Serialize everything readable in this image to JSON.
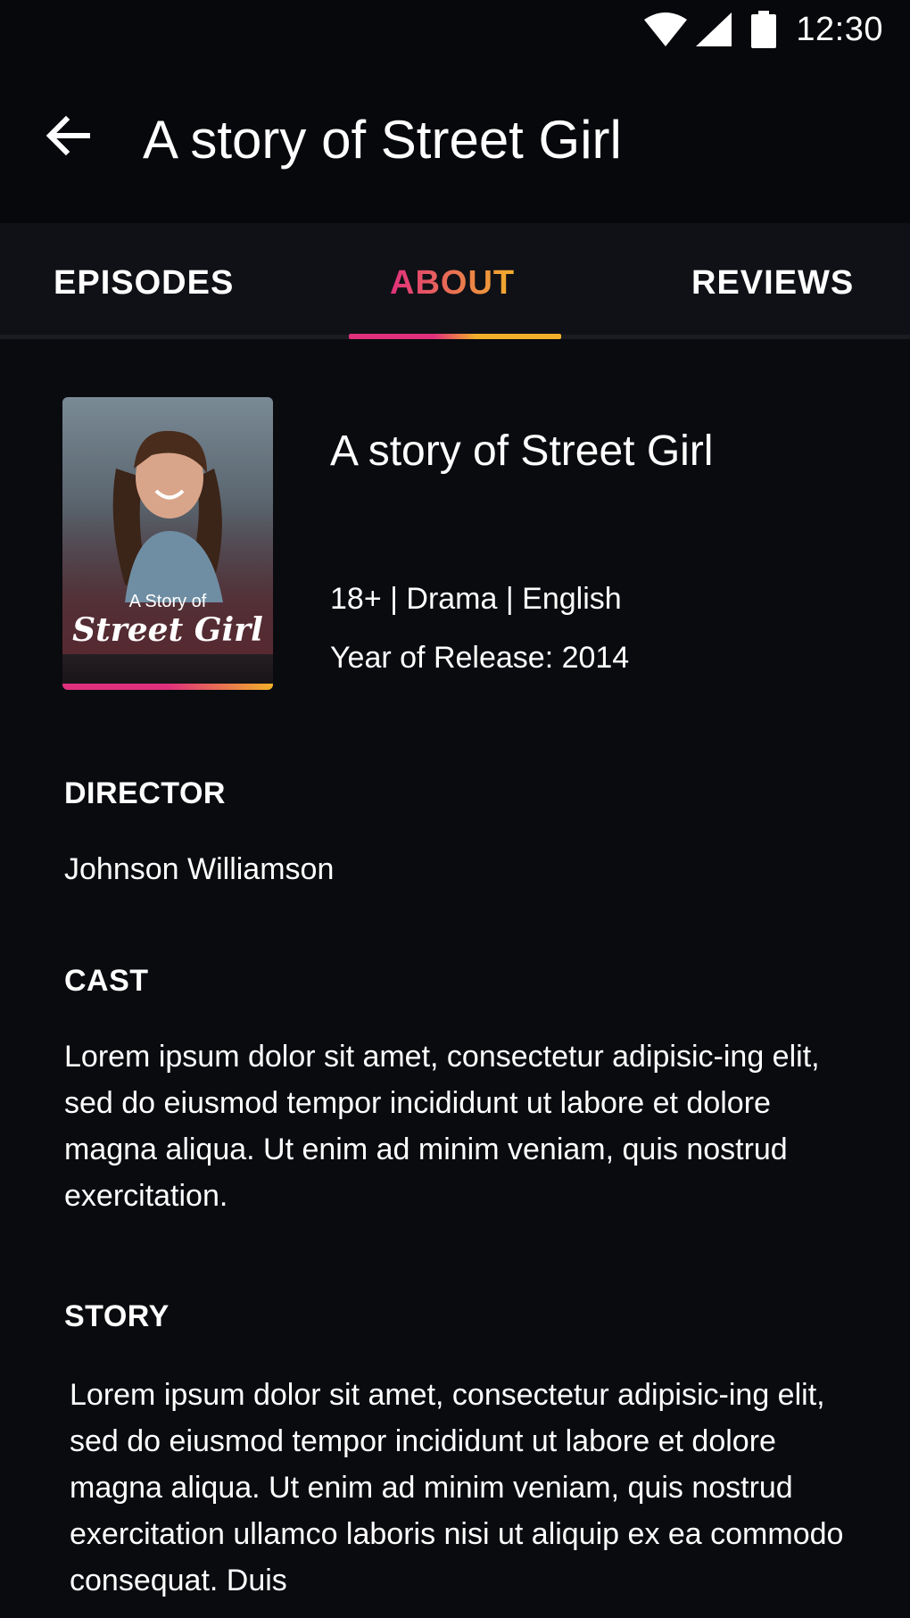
{
  "status_bar": {
    "time": "12:30",
    "icons": [
      "wifi-icon",
      "signal-icon",
      "battery-icon"
    ]
  },
  "app_bar": {
    "back_icon": "back-arrow-icon",
    "title": "A story of Street Girl"
  },
  "tabs": [
    {
      "label": "EPISODES",
      "active": false
    },
    {
      "label": "ABOUT",
      "active": true
    },
    {
      "label": "REVIEWS",
      "active": false
    }
  ],
  "colors": {
    "background": "#0a0b0f",
    "accent_pink": "#e0307c",
    "accent_yellow": "#f2b02a"
  },
  "poster": {
    "caption_small": "A Story of",
    "caption_big": "Street Girl"
  },
  "details": {
    "title": "A story of Street Girl",
    "meta": "18+  |  Drama | English",
    "year": "Year of Release: 2014"
  },
  "director": {
    "heading": "DIRECTOR",
    "name": "Johnson Williamson"
  },
  "cast": {
    "heading": "CAST",
    "text": "Lorem ipsum dolor sit amet, consectetur adipisic-ing elit, sed do eiusmod tempor incididunt ut labore et dolore magna aliqua. Ut enim ad minim veniam, quis nostrud exercitation."
  },
  "story": {
    "heading": "STORY",
    "text": "Lorem ipsum dolor sit amet, consectetur adipisic-ing elit, sed do eiusmod tempor incididunt ut labore et dolore magna aliqua. Ut enim ad minim veniam, quis nostrud exercitation ullamco laboris nisi ut aliquip ex ea commodo consequat. Duis"
  }
}
